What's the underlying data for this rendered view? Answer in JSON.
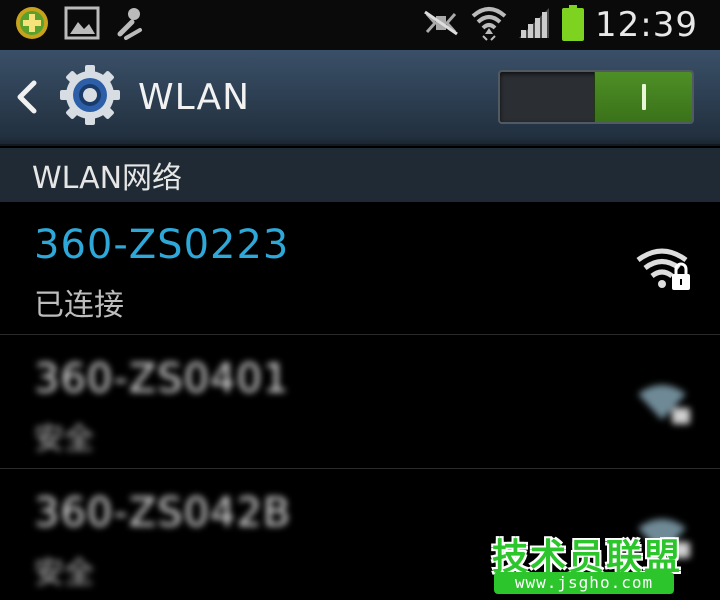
{
  "status_bar": {
    "time": "12:39",
    "icons": [
      "app-plus-icon",
      "gallery-icon",
      "usb-debug-icon",
      "mute-icon",
      "wifi-icon",
      "signal-icon",
      "battery-icon"
    ],
    "battery_color": "#7ed321"
  },
  "action_bar": {
    "title": "WLAN",
    "toggle_on": true,
    "toggle_color": "#4e8f26"
  },
  "section": {
    "header": "WLAN网络"
  },
  "networks": [
    {
      "ssid": "360-ZS0223",
      "status": "已连接",
      "connected": true,
      "secured": true
    },
    {
      "ssid": "360-ZS0401",
      "status": "安全",
      "connected": false,
      "secured": true
    },
    {
      "ssid": "360-ZS042B",
      "status": "安全",
      "connected": false,
      "secured": true
    }
  ],
  "watermark": {
    "title": "技术员联盟",
    "url": "www.jsgho.com"
  },
  "colors": {
    "accent": "#2ea8d8",
    "section_bg": "#1f2a34",
    "watermark_green": "#2cc52c"
  }
}
